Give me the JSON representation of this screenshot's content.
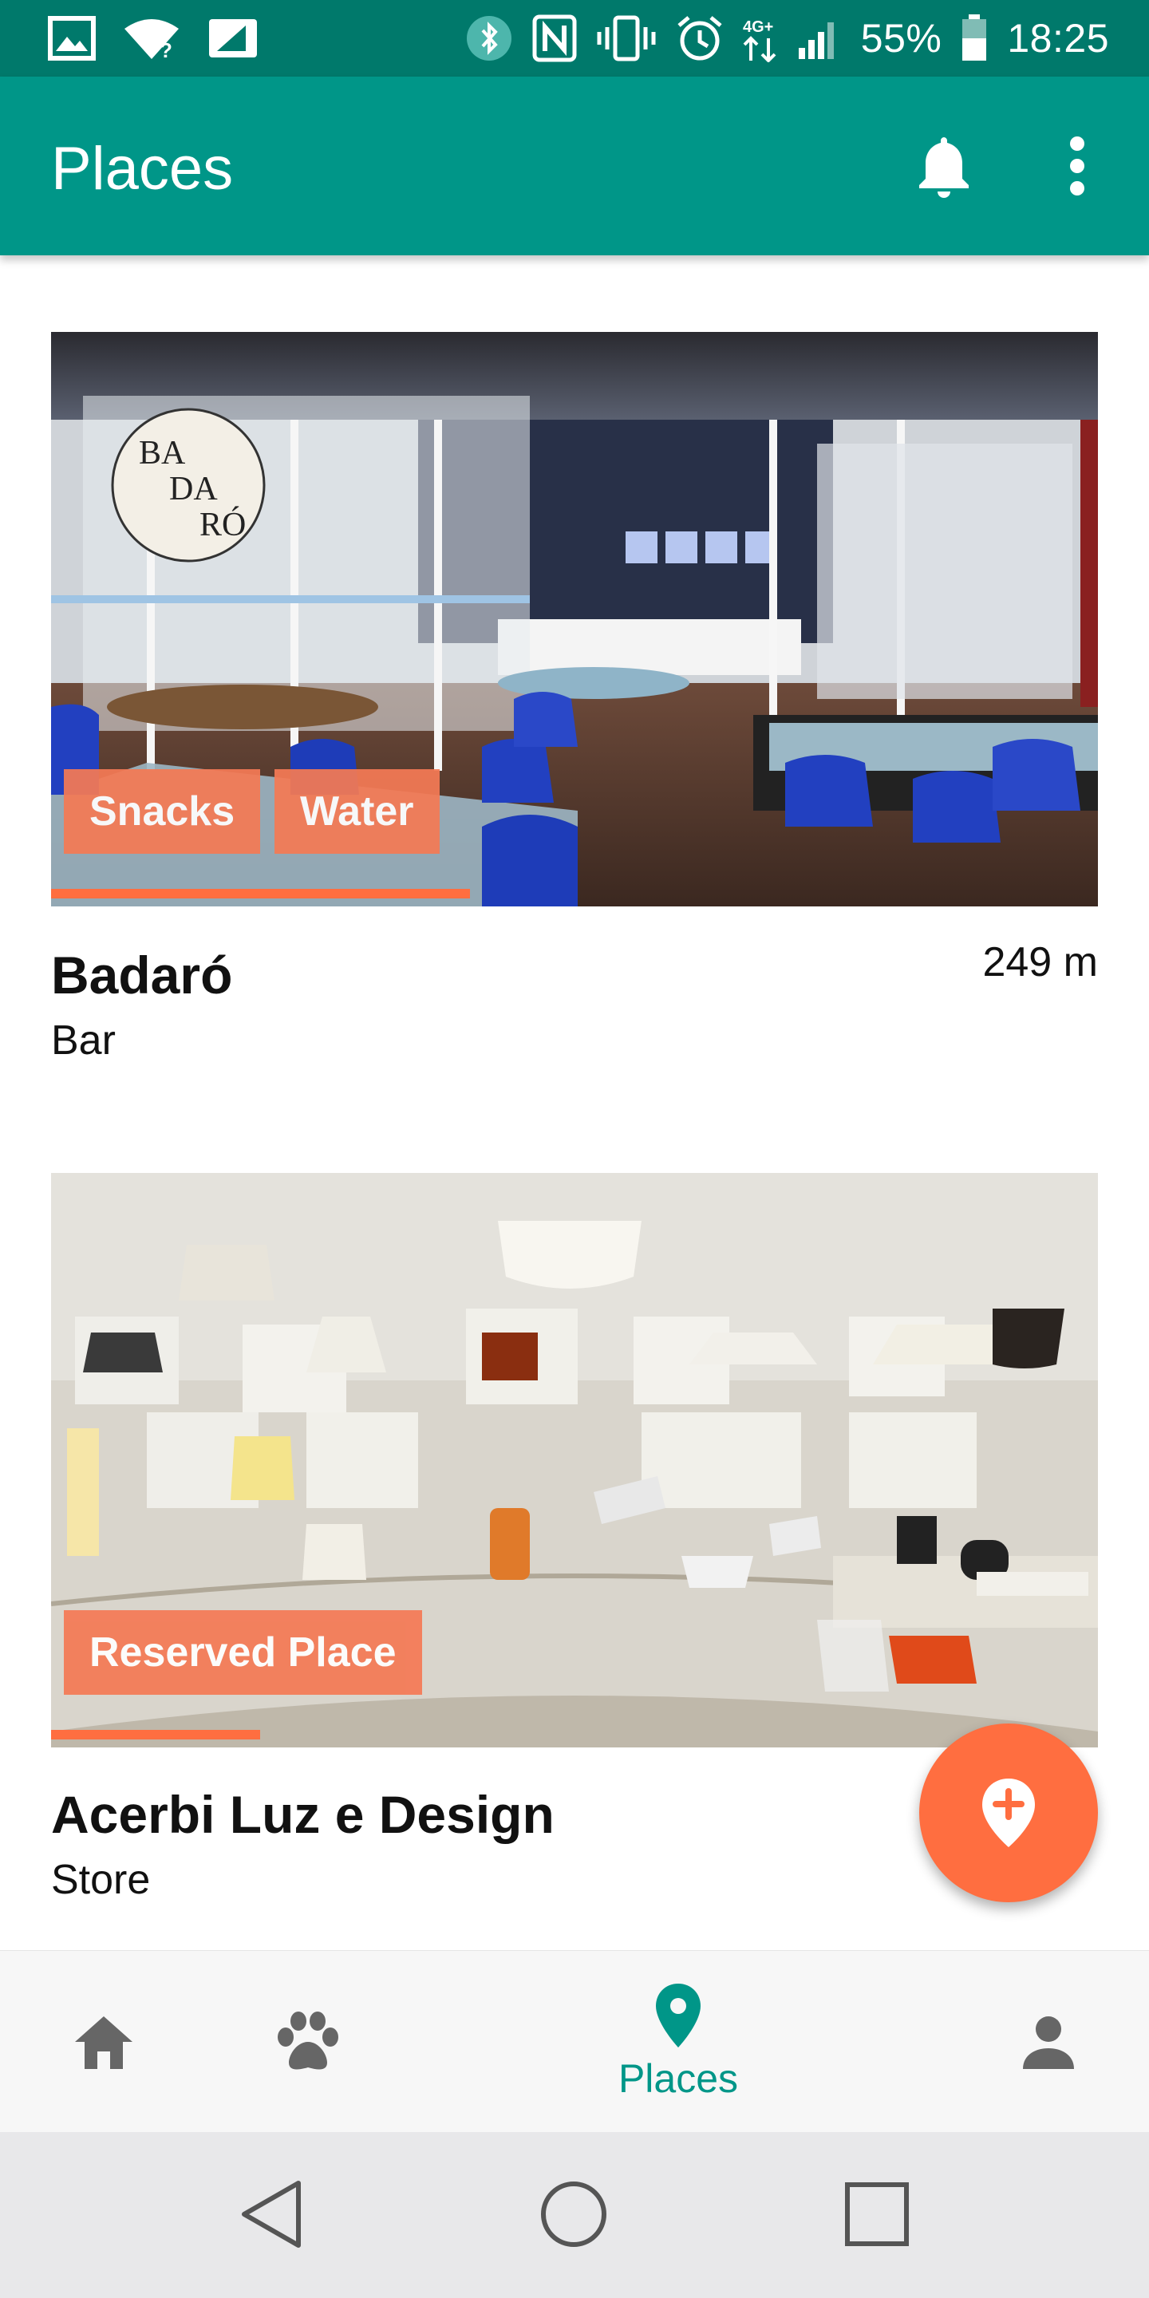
{
  "status_bar": {
    "battery": "55%",
    "time": "18:25",
    "network": "4G+"
  },
  "app_bar": {
    "title": "Places",
    "icons": [
      "notifications-icon",
      "more-vert-icon"
    ]
  },
  "places": [
    {
      "name": "Badaró",
      "type": "Bar",
      "distance": "249 m",
      "tags": [
        "Snacks",
        "Water"
      ],
      "progress": 0.4,
      "sign_text": [
        "BA",
        "DA",
        "RÓ"
      ]
    },
    {
      "name": "Acerbi Luz e Design",
      "type": "Store",
      "distance": "",
      "tags": [
        "Reserved Place"
      ],
      "progress": 0.2
    }
  ],
  "fab": {
    "icon": "add-location-icon"
  },
  "bottom_nav": {
    "items": [
      {
        "icon": "home-icon",
        "label": ""
      },
      {
        "icon": "pets-icon",
        "label": ""
      },
      {
        "icon": "place-icon",
        "label": "Places",
        "active": true
      },
      {
        "icon": "person-icon",
        "label": ""
      }
    ]
  },
  "colors": {
    "primary": "#009688",
    "primary_dark": "#00796b",
    "accent": "#ff6e40",
    "tag": "#f47a55"
  }
}
